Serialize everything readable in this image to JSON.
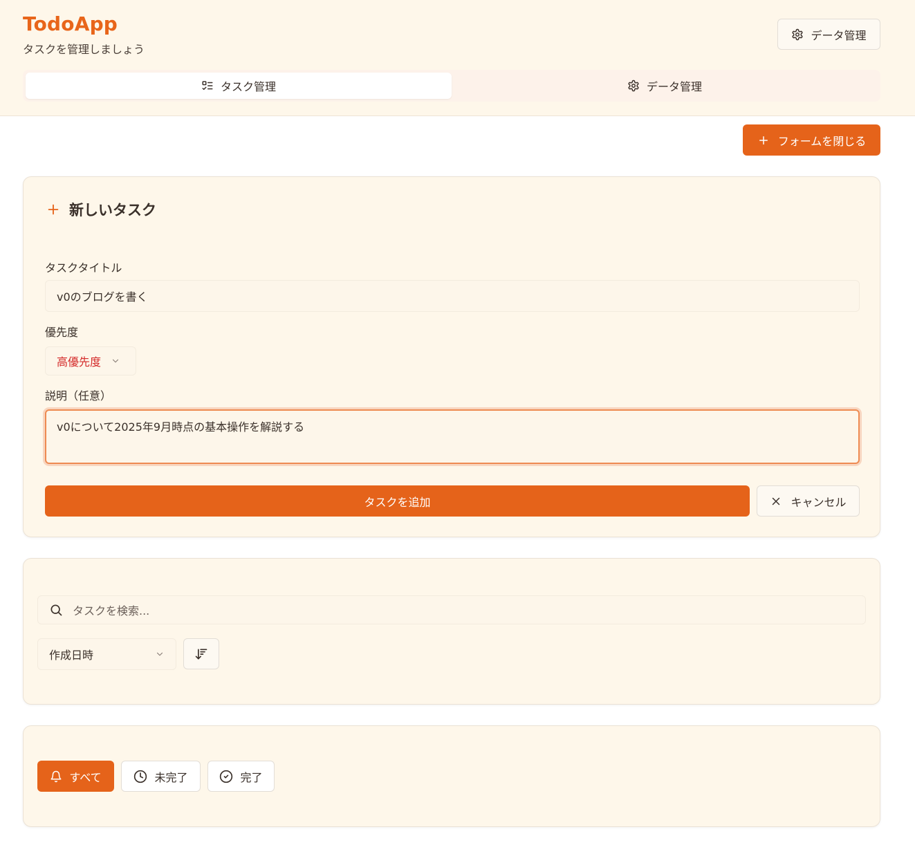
{
  "header": {
    "title": "TodoApp",
    "subtitle": "タスクを管理しましょう",
    "data_button_label": "データ管理"
  },
  "tabs": [
    {
      "label": "タスク管理",
      "icon": "list-checks-icon",
      "active": true
    },
    {
      "label": "データ管理",
      "icon": "gear-icon",
      "active": false
    }
  ],
  "toolbar": {
    "close_form_label": "フォームを閉じる"
  },
  "form": {
    "title": "新しいタスク",
    "title_label": "タスクタイトル",
    "title_value": "v0のブログを書く",
    "priority_label": "優先度",
    "priority_value": "高優先度",
    "description_label": "説明（任意）",
    "description_value": "v0について2025年9月時点の基本操作を解説する",
    "submit_label": "タスクを追加",
    "cancel_label": "キャンセル"
  },
  "search": {
    "placeholder": "タスクを検索...",
    "sort_value": "作成日時"
  },
  "filters": [
    {
      "label": "すべて",
      "icon": "bell-icon",
      "active": true
    },
    {
      "label": "未完了",
      "icon": "clock-icon",
      "active": false
    },
    {
      "label": "完了",
      "icon": "check-circle-icon",
      "active": false
    }
  ],
  "colors": {
    "accent": "#e5631a",
    "header_bg": "#fef7ea",
    "priority_high": "#d42a2a"
  }
}
